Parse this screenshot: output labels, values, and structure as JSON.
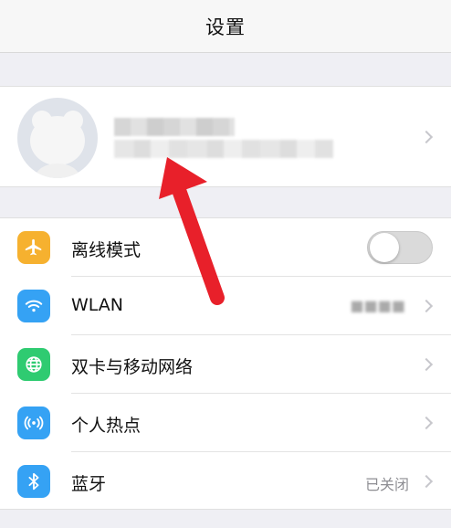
{
  "navbar": {
    "title": "设置"
  },
  "profile": {
    "name_blurred": "",
    "id_blurred": ""
  },
  "settings": [
    {
      "label": "离线模式",
      "icon": "airplane-icon",
      "icon_color": "#f6b12f",
      "control": "toggle",
      "toggle_on": false
    },
    {
      "label": "WLAN",
      "icon": "wifi-icon",
      "icon_color": "#35a2f4",
      "value": "■■■■",
      "control": "chevron"
    },
    {
      "label": "双卡与移动网络",
      "icon": "globe-icon",
      "icon_color": "#2fcb71",
      "control": "chevron"
    },
    {
      "label": "个人热点",
      "icon": "hotspot-icon",
      "icon_color": "#35a2f4",
      "control": "chevron"
    },
    {
      "label": "蓝牙",
      "icon": "bluetooth-icon",
      "icon_color": "#35a2f4",
      "value": "已关闭",
      "control": "chevron"
    }
  ],
  "annotation": {
    "arrow_color": "#e8202a"
  }
}
